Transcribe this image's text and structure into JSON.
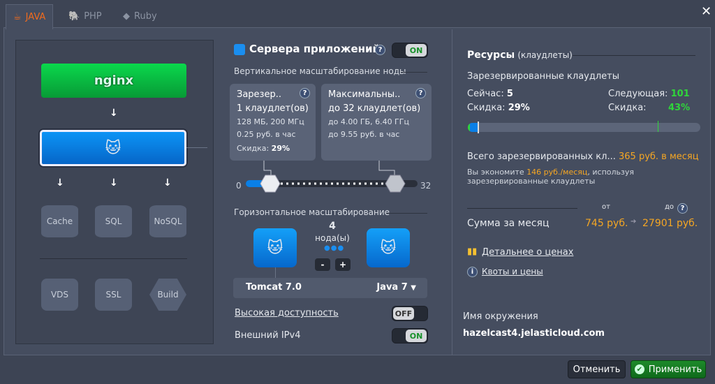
{
  "tabs": [
    {
      "label": "JAVA",
      "icon": "java-cup-icon"
    },
    {
      "label": "PHP",
      "icon": "php-elephant-icon"
    },
    {
      "label": "Ruby",
      "icon": "ruby-icon"
    }
  ],
  "topology": {
    "balancer": "nginx",
    "app_server": "tomcat",
    "arrows": "↓",
    "databases": [
      "Cache",
      "SQL",
      "NoSQL"
    ],
    "extras": [
      "VDS",
      "SSL",
      "Build"
    ]
  },
  "app_servers": {
    "title": "Сервера приложений",
    "toggle": "ON",
    "vertical_title": "Вертикальное масштабирование ноды",
    "reserved": {
      "title": "Зарезер..",
      "cloudlets": "1 клаудлет(ов)",
      "spec": "128 МБ, 200 МГц",
      "price": "0.25 руб. в час",
      "discount_label": "Скидка:",
      "discount": "29%"
    },
    "max": {
      "title": "Максимальны..",
      "cloudlets": "до 32 клаудлет(ов)",
      "spec": "до 4.00 ГБ, 6.40 ГГц",
      "price": "до 9.55 руб. в час"
    },
    "slider": {
      "min": "0",
      "max": "32",
      "reserved_value": 1,
      "max_value": 32
    },
    "horizontal_title": "Горизонтальное масштабирование",
    "nodes_count": "4",
    "nodes_label": "нода(ы)",
    "minus": "-",
    "plus": "+",
    "server_name": "Tomcat 7.0",
    "java_version": "Java 7",
    "ha_label": "Высокая доступность",
    "ha_toggle": "OFF",
    "ipv4_label": "Внешний IPv4",
    "ipv4_toggle": "ON"
  },
  "resources": {
    "title": "Ресурсы",
    "title_sub": "(клаудлеты)",
    "reserved_title": "Зарезервированные клаудлеты",
    "now_label": "Сейчас:",
    "now": "5",
    "next_label": "Следующая:",
    "next": "101",
    "discount_label": "Скидка:",
    "discount": "29%",
    "next_discount": "43%",
    "total_label": "Всего зарезервированных кл...",
    "total": "365 руб. в месяц",
    "save_pre": "Вы экономите",
    "save_amount": "146 руб./месяц",
    "save_post": ", используя зарезервированные клаудлеты",
    "from_label": "от",
    "to_label": "до",
    "month_label": "Сумма за месяц",
    "from": "745 руб.",
    "to": "27901 руб.",
    "pricing_link": "Детальнее о ценах",
    "quotas_link": "Квоты и цены",
    "env_label": "Имя окружения",
    "env_name": "hazelcast4.jelasticloud.com"
  },
  "footer": {
    "cancel": "Отменить",
    "apply": "Применить"
  },
  "colors": {
    "accent_orange": "#f5a623",
    "green": "#2fd63a",
    "blue": "#0a7fe6"
  }
}
